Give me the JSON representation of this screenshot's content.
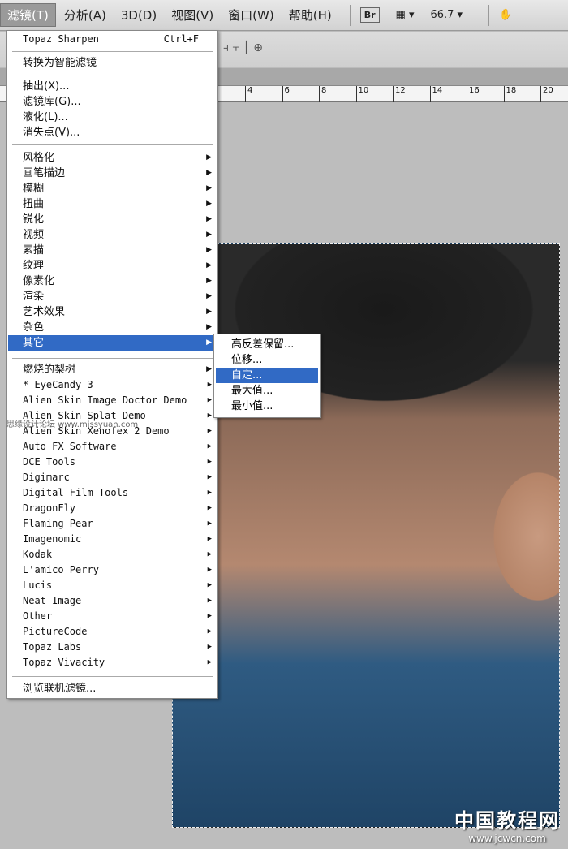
{
  "menubar": {
    "items": [
      "滤镜(T)",
      "分析(A)",
      "3D(D)",
      "视图(V)",
      "窗口(W)",
      "帮助(H)"
    ],
    "bridge": "Br",
    "zoom": "66.7 ▾",
    "screen_mode": "▾"
  },
  "ruler": {
    "ticks": [
      "4",
      "6",
      "8",
      "10",
      "12",
      "14",
      "16",
      "18",
      "20"
    ]
  },
  "filter_menu": {
    "last_filter": {
      "label": "Topaz Sharpen",
      "shortcut": "Ctrl+F"
    },
    "smart": "转换为智能滤镜",
    "group1": [
      "抽出(X)...",
      "滤镜库(G)...",
      "液化(L)...",
      "消失点(V)..."
    ],
    "group2": [
      "风格化",
      "画笔描边",
      "模糊",
      "扭曲",
      "锐化",
      "视频",
      "素描",
      "纹理",
      "像素化",
      "渲染",
      "艺术效果",
      "杂色",
      "其它"
    ],
    "highlighted": "其它",
    "group3": [
      "燃烧的梨树",
      "* EyeCandy 3",
      "Alien Skin Image Doctor Demo",
      "Alien Skin Splat Demo",
      "Alien Skin Xenofex 2 Demo",
      "Auto FX Software",
      "DCE Tools",
      "Digimarc",
      "Digital Film Tools",
      "DragonFly",
      "Flaming Pear",
      "Imagenomic",
      "Kodak",
      "L'amico Perry",
      "Lucis",
      "Neat Image",
      "Other",
      "PictureCode",
      "Topaz Labs",
      "Topaz Vivacity"
    ],
    "browse": "浏览联机滤镜..."
  },
  "submenu": {
    "items": [
      "高反差保留...",
      "位移...",
      "自定...",
      "最大值...",
      "最小值..."
    ],
    "highlighted": "自定..."
  },
  "watermark": {
    "title": "中国教程网",
    "url": "www.jcwcn.com",
    "left": "思缘设计论坛 www.missyuan.com"
  },
  "colors": {
    "highlight": "#316ac5"
  }
}
